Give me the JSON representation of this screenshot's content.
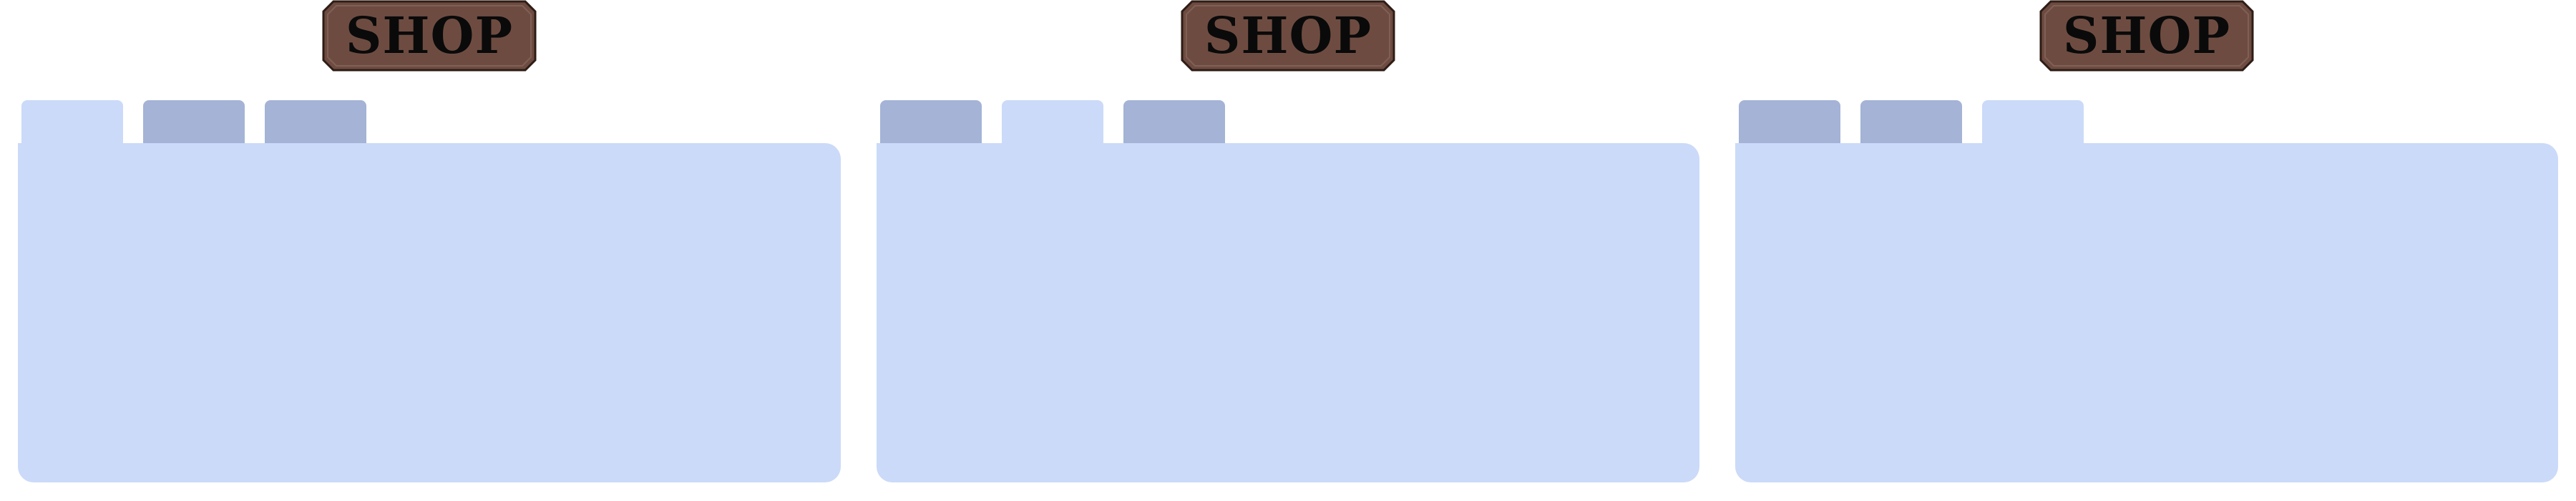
{
  "colors": {
    "background": "#ffffff",
    "panel_fill": "#cbdaf8",
    "tab_inactive": "#a4b3d6",
    "tab_active": "#cbdaf8",
    "shop_badge_fill": "#6e4b40",
    "shop_badge_border": "#2e1c16",
    "shop_label": "#0a0a0a"
  },
  "panels": [
    {
      "shop_button": {
        "label": "SHOP",
        "icon": "shop-sign-icon"
      },
      "active_tab": 1,
      "tabs": [
        {
          "label": ""
        },
        {
          "label": ""
        },
        {
          "label": ""
        }
      ]
    },
    {
      "shop_button": {
        "label": "SHOP",
        "icon": "shop-sign-icon"
      },
      "active_tab": 2,
      "tabs": [
        {
          "label": ""
        },
        {
          "label": ""
        },
        {
          "label": ""
        }
      ]
    },
    {
      "shop_button": {
        "label": "SHOP",
        "icon": "shop-sign-icon"
      },
      "active_tab": 3,
      "tabs": [
        {
          "label": ""
        },
        {
          "label": ""
        },
        {
          "label": ""
        }
      ]
    }
  ]
}
